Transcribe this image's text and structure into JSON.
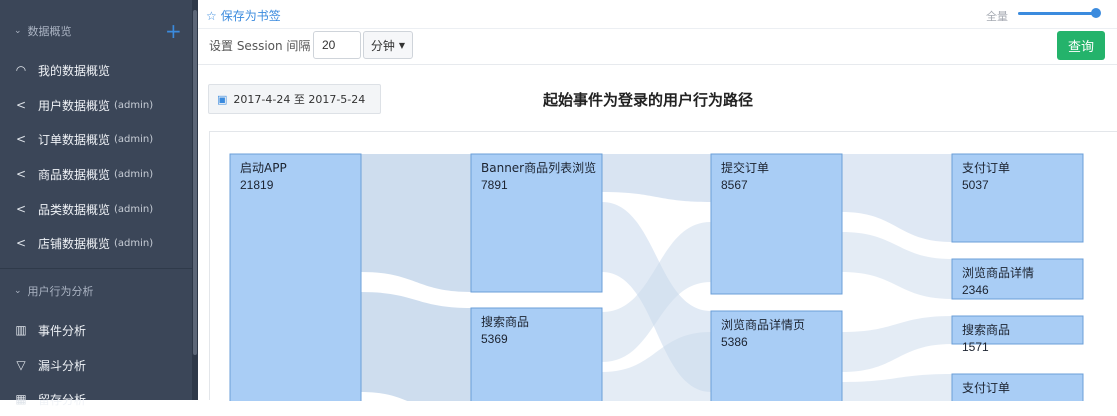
{
  "sidebar": {
    "section1_title": "数据概览",
    "section2_title": "用户行为分析",
    "items": [
      {
        "label": "我的数据概览",
        "suffix": "",
        "icon": "headphone-icon"
      },
      {
        "label": "用户数据概览",
        "suffix": "(admin)",
        "icon": "share-icon"
      },
      {
        "label": "订单数据概览",
        "suffix": "(admin)",
        "icon": "share-icon"
      },
      {
        "label": "商品数据概览",
        "suffix": "(admin)",
        "icon": "share-icon"
      },
      {
        "label": "品类数据概览",
        "suffix": "(admin)",
        "icon": "share-icon"
      },
      {
        "label": "店铺数据概览",
        "suffix": "(admin)",
        "icon": "share-icon"
      }
    ],
    "items2": [
      {
        "label": "事件分析",
        "icon": "bar-chart-icon"
      },
      {
        "label": "漏斗分析",
        "icon": "funnel-icon"
      },
      {
        "label": "留存分析",
        "icon": "grid-icon"
      }
    ]
  },
  "topbar": {
    "bookmark_label": "保存为书签",
    "fullscreen_label": "全量",
    "fullscreen_level": 1.0
  },
  "controls": {
    "session_label": "设置 Session 间隔",
    "session_value": "20",
    "unit_label": "分钟",
    "query_label": "查询",
    "date_range": "2017-4-24 至 2017-5-24"
  },
  "chart": {
    "title": "起始事件为登录的用户行为路径"
  },
  "colors": {
    "sidebar_bg": "#3b4658",
    "accent": "#3b8bde",
    "query_green": "#24b36b",
    "node_fill": "#a9cdf5",
    "node_border": "#6b9fd8",
    "link": "#c9d9ec"
  },
  "chart_data": {
    "type": "sankey",
    "title": "起始事件为登录的用户行为路径",
    "columns": [
      [
        {
          "name": "启动APP",
          "value": 21819
        }
      ],
      [
        {
          "name": "Banner商品列表浏览",
          "value": 7891
        },
        {
          "name": "搜索商品",
          "value": 5369
        }
      ],
      [
        {
          "name": "提交订单",
          "value": 8567
        },
        {
          "name": "浏览商品详情页",
          "value": 5386
        }
      ],
      [
        {
          "name": "支付订单",
          "value": 5037
        },
        {
          "name": "浏览商品详情",
          "value": 2346
        },
        {
          "name": "搜索商品",
          "value": 1571
        },
        {
          "name": "支付订单",
          "value": null
        }
      ]
    ]
  }
}
